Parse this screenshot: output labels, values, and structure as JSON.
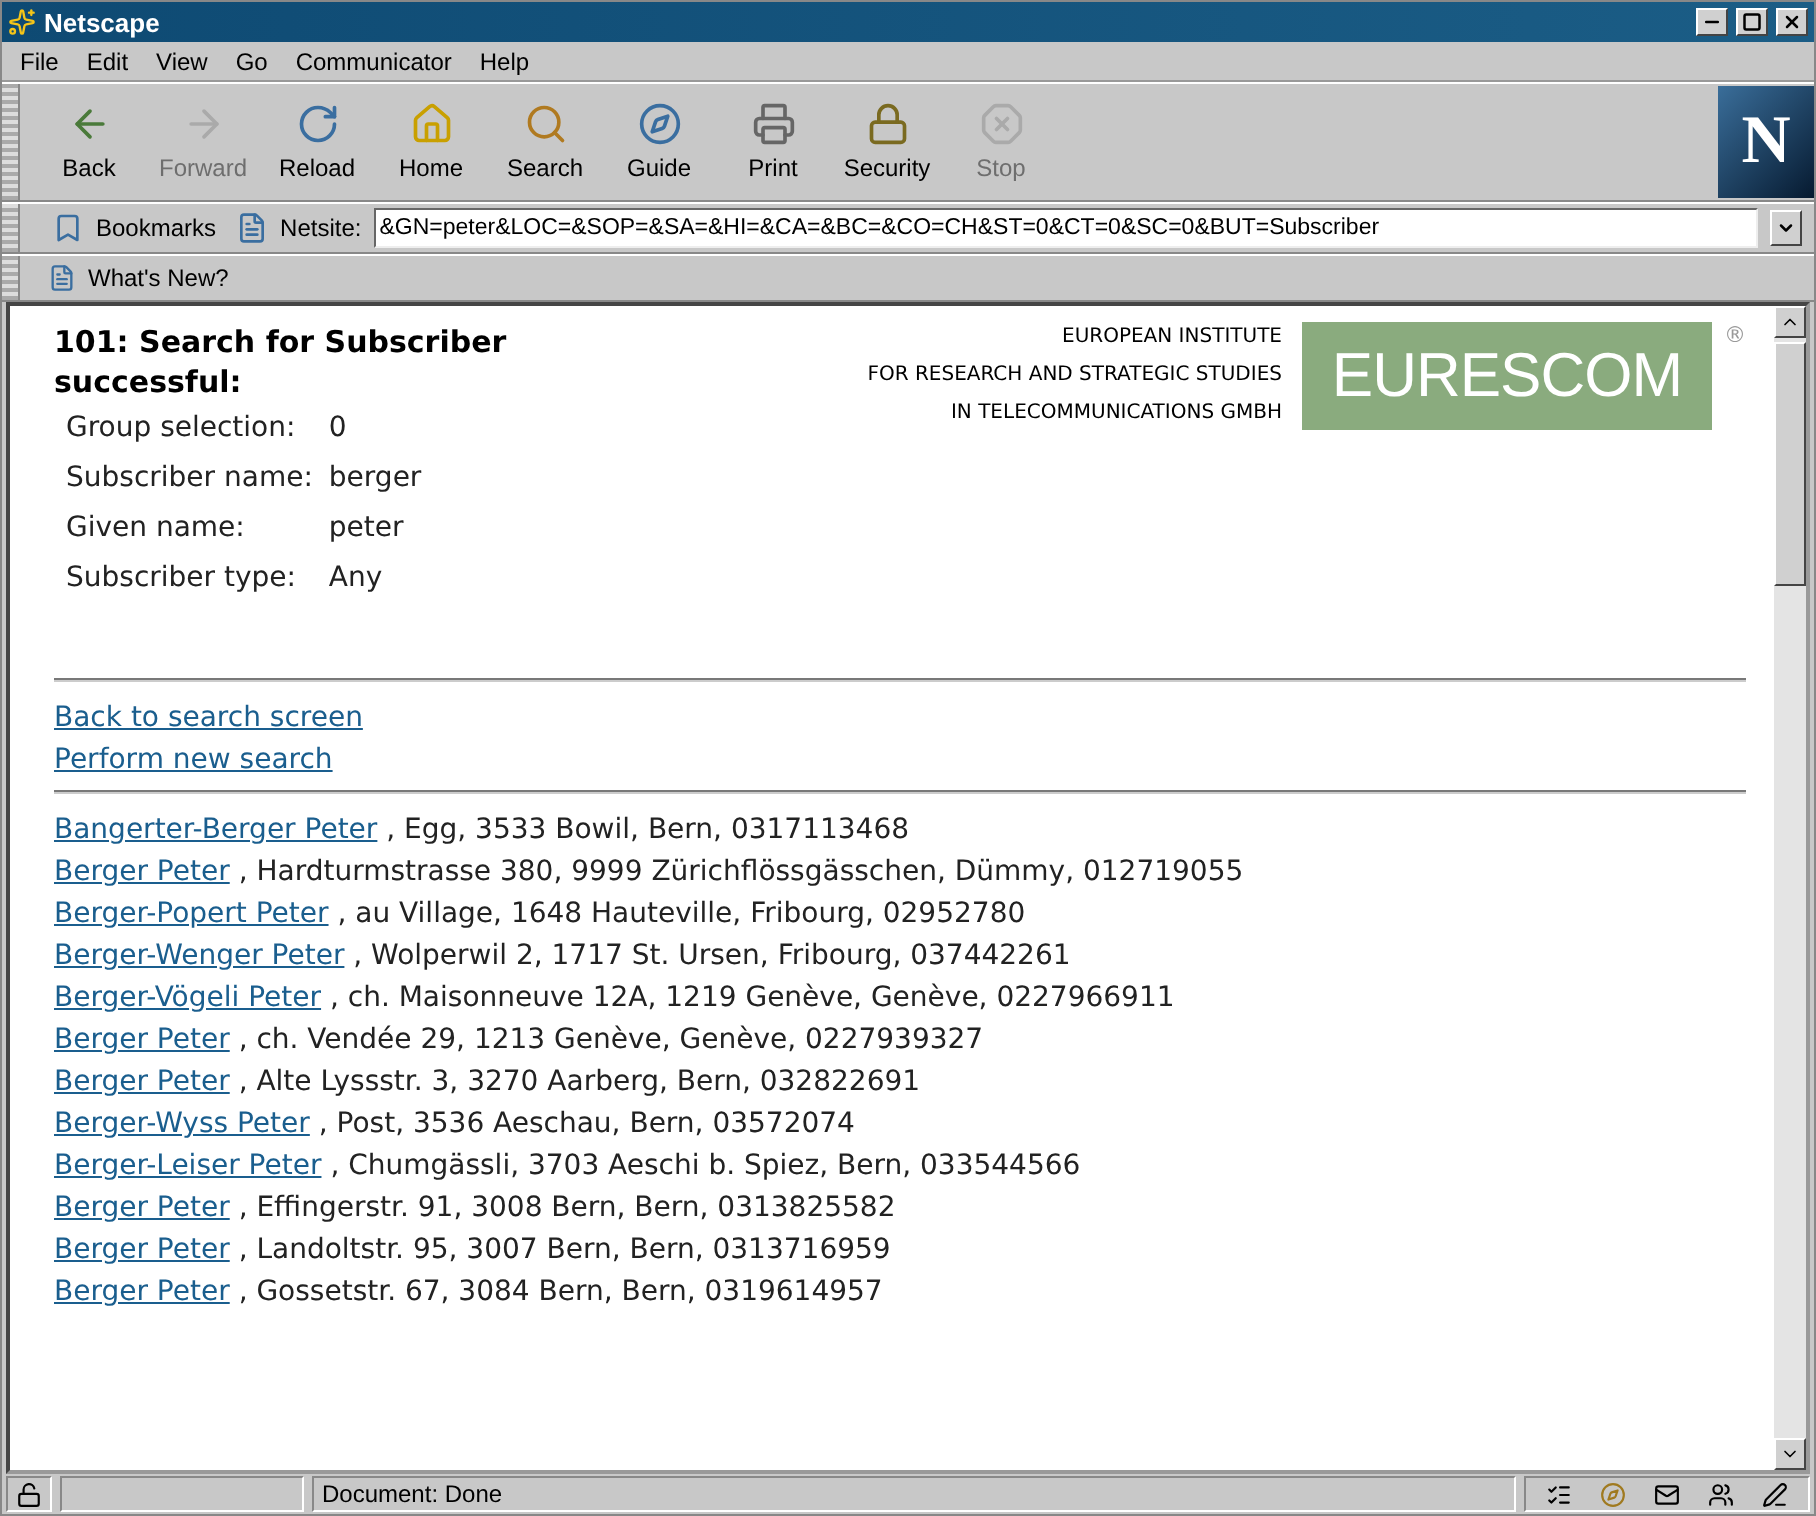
{
  "window": {
    "title": "Netscape"
  },
  "menu": [
    "File",
    "Edit",
    "View",
    "Go",
    "Communicator",
    "Help"
  ],
  "toolbar": [
    {
      "label": "Back",
      "disabled": false
    },
    {
      "label": "Forward",
      "disabled": true
    },
    {
      "label": "Reload",
      "disabled": false
    },
    {
      "label": "Home",
      "disabled": false
    },
    {
      "label": "Search",
      "disabled": false
    },
    {
      "label": "Guide",
      "disabled": false
    },
    {
      "label": "Print",
      "disabled": false
    },
    {
      "label": "Security",
      "disabled": false
    },
    {
      "label": "Stop",
      "disabled": true
    }
  ],
  "brand_logo": "N",
  "location_bar": {
    "bookmarks": "Bookmarks",
    "label": "Netsite:",
    "url": "&GN=peter&LOC=&SOP=&SA=&HI=&CA=&BC=&CO=CH&ST=0&CT=0&SC=0&BUT=Subscriber"
  },
  "personal_bar": [
    "What's New?"
  ],
  "page": {
    "heading": "101: Search for Subscriber successful:",
    "criteria": [
      {
        "label": "Group selection:",
        "value": "0"
      },
      {
        "label": "Subscriber name:",
        "value": "berger"
      },
      {
        "label": "Given name:",
        "value": "peter"
      },
      {
        "label": "Subscriber type:",
        "value": "Any"
      }
    ],
    "institute": [
      "EUROPEAN INSTITUTE",
      "FOR RESEARCH AND STRATEGIC STUDIES",
      "IN TELECOMMUNICATIONS GMBH"
    ],
    "logo": {
      "text": "EURESCOM",
      "mark": "®"
    },
    "links": [
      "Back to search screen",
      "Perform new search"
    ],
    "results": [
      {
        "name": "Bangerter-Berger Peter",
        "details": ", Egg, 3533 Bowil, Bern, 0317113468"
      },
      {
        "name": "Berger Peter",
        "details": ", Hardturmstrasse 380, 9999 Zürichflössgässchen, Dümmy, 012719055"
      },
      {
        "name": "Berger-Popert Peter",
        "details": ", au Village, 1648 Hauteville, Fribourg, 02952780"
      },
      {
        "name": "Berger-Wenger Peter",
        "details": ", Wolperwil 2, 1717 St. Ursen, Fribourg, 037442261"
      },
      {
        "name": "Berger-Vögeli Peter",
        "details": ", ch. Maisonneuve 12A, 1219 Genève, Genève, 0227966911"
      },
      {
        "name": "Berger Peter",
        "details": ", ch. Vendée 29, 1213 Genève, Genève, 0227939327"
      },
      {
        "name": "Berger Peter",
        "details": ", Alte Lyssstr. 3, 3270 Aarberg, Bern, 032822691"
      },
      {
        "name": "Berger-Wyss Peter",
        "details": ", Post, 3536 Aeschau, Bern, 03572074"
      },
      {
        "name": "Berger-Leiser Peter",
        "details": ", Chumgässli, 3703 Aeschi b. Spiez, Bern, 033544566"
      },
      {
        "name": "Berger Peter",
        "details": ", Effingerstr. 91, 3008 Bern, Bern, 0313825582"
      },
      {
        "name": "Berger Peter",
        "details": ", Landoltstr. 95, 3007 Bern, Bern, 0313716959"
      },
      {
        "name": "Berger Peter",
        "details": ", Gossetstr. 67, 3084 Bern, Bern, 0319614957"
      }
    ]
  },
  "status_bar": {
    "text": "Document: Done"
  }
}
